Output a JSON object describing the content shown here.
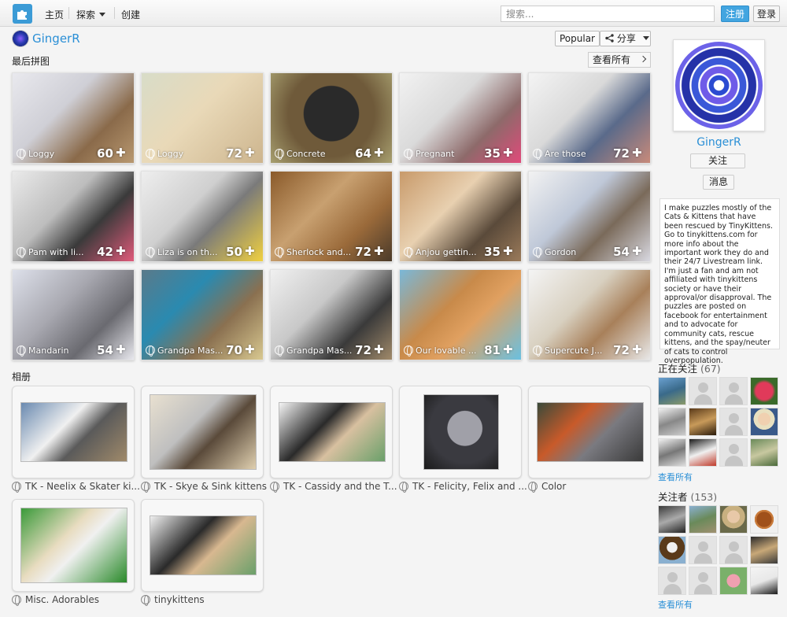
{
  "nav": {
    "home": "主页",
    "explore": "探索",
    "create": "创建",
    "search_placeholder": "搜索...",
    "register": "注册",
    "login": "登录"
  },
  "header": {
    "username": "GingerR",
    "popular": "Popular",
    "share": "分享"
  },
  "recent": {
    "title": "最后拼图",
    "view_all": "查看所有",
    "puzzles": [
      {
        "title": "Loggy",
        "count": "60"
      },
      {
        "title": "Loggy",
        "count": "72"
      },
      {
        "title": "Concrete",
        "count": "64"
      },
      {
        "title": "Pregnant",
        "count": "35"
      },
      {
        "title": "Are those",
        "count": "72"
      },
      {
        "title": "Pam with li...",
        "count": "42"
      },
      {
        "title": "Liza is on th...",
        "count": "50"
      },
      {
        "title": "Sherlock and...",
        "count": "72"
      },
      {
        "title": "Anjou gettin...",
        "count": "35"
      },
      {
        "title": "Gordon",
        "count": "54"
      },
      {
        "title": "Mandarin",
        "count": "54"
      },
      {
        "title": "Grandpa Mas...",
        "count": "70"
      },
      {
        "title": "Grandpa Mas...",
        "count": "72"
      },
      {
        "title": "Our lovable ...",
        "count": "81"
      },
      {
        "title": "Supercute J...",
        "count": "72"
      }
    ]
  },
  "albums": {
    "title": "相册",
    "items": [
      {
        "label": "TK - Neelix & Skater ki..."
      },
      {
        "label": "TK - Skye & Sink kittens"
      },
      {
        "label": "TK - Cassidy and the T..."
      },
      {
        "label": "TK - Felicity, Felix and ..."
      },
      {
        "label": "Color"
      },
      {
        "label": "Misc. Adorables"
      },
      {
        "label": "tinykittens"
      }
    ]
  },
  "sidebar": {
    "name": "GingerR",
    "follow": "关注",
    "message": "消息",
    "bio": "I make puzzles mostly of the Cats & Kittens that have been rescued by TinyKittens. Go to tinykittens.com for more info about the important work they do and their 24/7 Livestream link. I'm just a fan and am not affiliated with tinykittens society or have their approval/or disapproval. The puzzles are posted on facebook for entertainment and to advocate for community cats, rescue kittens, and the spay/neuter of cats to control overpopulation.",
    "following_label": "正在关注",
    "following_count": "(67)",
    "following_view_all": "查看所有",
    "followers_label": "关注者",
    "followers_count": "(153)",
    "followers_view_all": "查看所有"
  },
  "colors": {
    "accent": "#2a8fd6",
    "register_button": "#42a5e0",
    "background": "#f4f4f4"
  }
}
